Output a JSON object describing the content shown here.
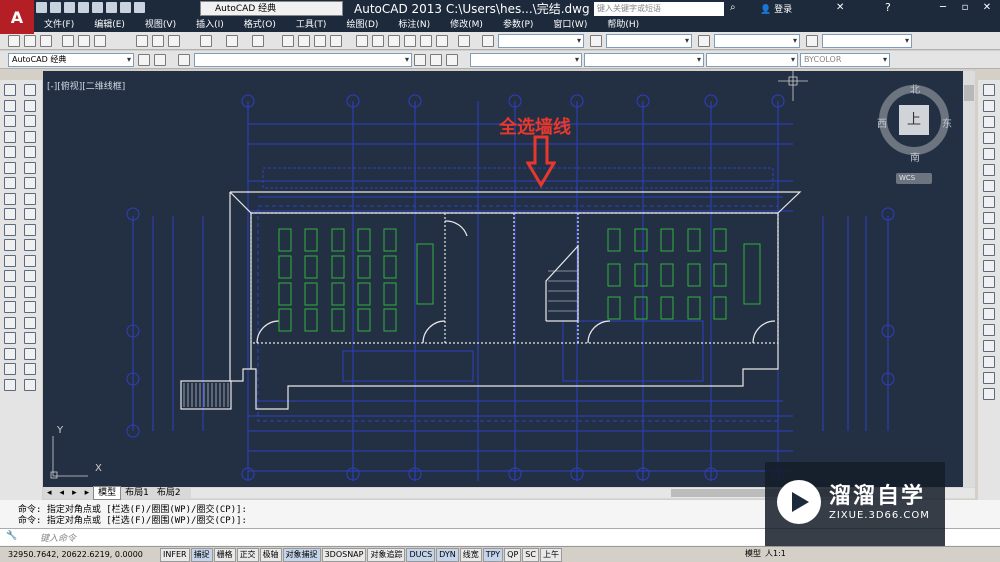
{
  "app": {
    "title": "AutoCAD 2013    C:\\Users\\hes...\\完结.dwg",
    "workspace": "AutoCAD 经典",
    "search_placeholder": "键入关键字或短语",
    "login_label": "登录"
  },
  "menu": [
    "文件(F)",
    "编辑(E)",
    "视图(V)",
    "插入(I)",
    "格式(O)",
    "工具(T)",
    "绘图(D)",
    "标注(N)",
    "修改(M)",
    "参数(P)",
    "窗口(W)",
    "帮助(H)"
  ],
  "toolbar2": {
    "workspace": "AutoCAD 经典",
    "color": "BYCOLOR"
  },
  "viewport": {
    "label": "[-][俯视][二维线框]",
    "annotation": "全选墙线",
    "compass": {
      "north": "北",
      "south": "南",
      "east": "东",
      "west": "西",
      "center": "上",
      "wcs": "WCS"
    },
    "ucs_x": "X",
    "ucs_y": "Y"
  },
  "layout_tabs": [
    "模型",
    "布局1",
    "布局2"
  ],
  "command": {
    "lines": [
      "命令: 指定对角点或 [栏选(F)/圈围(WP)/圈交(CP)]:",
      "命令: 指定对角点或 [栏选(F)/圈围(WP)/圈交(CP)]:"
    ],
    "prompt": "键入命令"
  },
  "status": {
    "coords": "32950.7642, 20622.6219, 0.0000",
    "buttons": [
      "INFER",
      "捕捉",
      "栅格",
      "正交",
      "极轴",
      "对象捕捉",
      "3DOSNAP",
      "对象追踪",
      "DUCS",
      "DYN",
      "线宽",
      "TPY",
      "QP",
      "SC",
      "上午"
    ],
    "model": "模型",
    "scale": "人1:1"
  },
  "watermark": {
    "title": "溜溜自学",
    "url": "ZIXUE.3D66.COM"
  },
  "colors": {
    "accent": "#e8382e",
    "viewport": "#233044",
    "drawing_blue": "#2f3fbf",
    "drawing_green": "#2fb33a"
  }
}
